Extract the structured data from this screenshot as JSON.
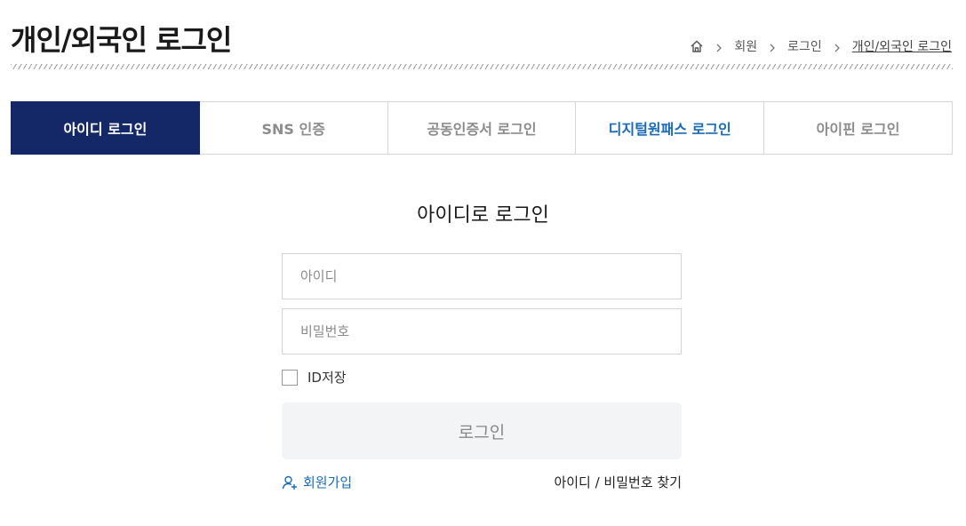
{
  "page": {
    "title": "개인/외국인 로그인"
  },
  "breadcrumb": {
    "items": [
      "회원",
      "로그인",
      "개인/외국인 로그인"
    ]
  },
  "tabs": [
    {
      "label": "아이디 로그인",
      "active": true
    },
    {
      "label": "SNS 인증",
      "active": false
    },
    {
      "label": "공동인증서 로그인",
      "active": false
    },
    {
      "label": "디지털원패스 로그인",
      "active": false
    },
    {
      "label": "아이핀 로그인",
      "active": false
    }
  ],
  "login": {
    "heading": "아이디로 로그인",
    "id_placeholder": "아이디",
    "password_placeholder": "비밀번호",
    "save_id_label": "ID저장",
    "submit_label": "로그인",
    "signup_label": "회원가입",
    "find_label": "아이디 / 비밀번호 찾기"
  },
  "colors": {
    "active_tab": "#142766",
    "link": "#1a6bb5"
  }
}
